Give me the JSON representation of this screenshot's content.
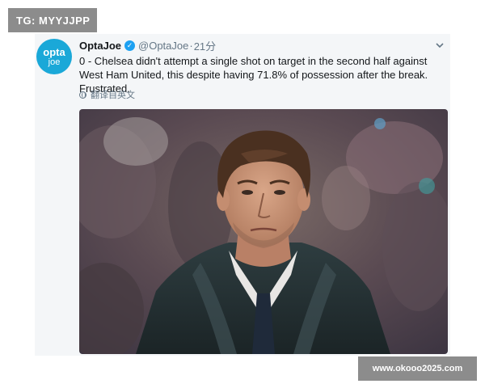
{
  "overlay": {
    "tg_label": "TG: MYYJJPP",
    "watermark": "www.okooo2025.com"
  },
  "tweet": {
    "avatar": {
      "line1": "opta",
      "line2": "joe"
    },
    "display_name": "OptaJoe",
    "handle": "@OptaJoe",
    "separator": "·",
    "time": "21分",
    "text": "0 - Chelsea didn't attempt a single shot on target in the second half against West Ham United, this despite having 71.8% of possession after the break. Frustrated.",
    "translate_label": "翻译自英文"
  },
  "icons": {
    "verified": "verified-badge-icon",
    "chevron": "chevron-down-icon",
    "translate": "globe-icon"
  },
  "colors": {
    "accent": "#1da1f2",
    "avatar_bg": "#1aa8d8",
    "card_bg": "#f4f6f8",
    "label_bg": "#8c8c8c"
  }
}
